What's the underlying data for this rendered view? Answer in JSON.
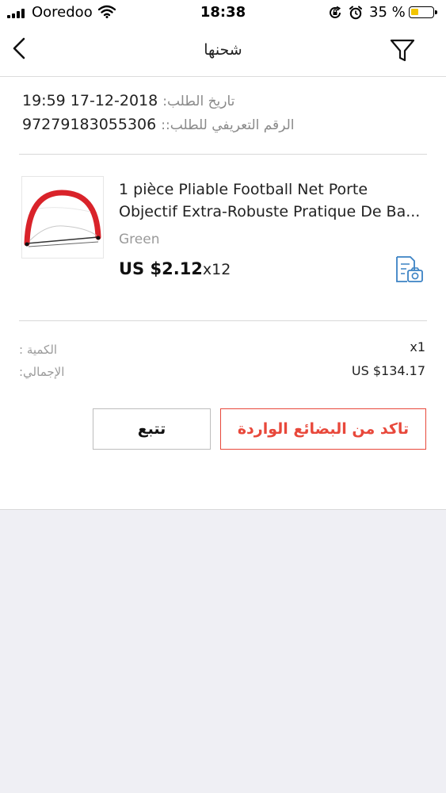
{
  "status_bar": {
    "carrier": "Ooredoo",
    "time": "18:38",
    "battery": "35 %",
    "battery_color": "#f2c500"
  },
  "nav": {
    "back_icon": "chevron-left-icon",
    "title": "شحنها",
    "filter_icon": "filter-icon"
  },
  "order": {
    "date_label": "تاريخ الطلب:",
    "date_value": "19:59 17-12-2018",
    "id_label": "الرقم التعريفي للطلب::",
    "id_value": "97279183055306"
  },
  "product": {
    "title_line1": "1 pièce Pliable Football Net Porte",
    "title_line2": "Objectif Extra-Robuste Pratique De Ba...",
    "color": "Green",
    "price": "US $2.12",
    "quantity": "x12",
    "snapshot_icon": "order-snapshot-icon"
  },
  "summary": {
    "qty_label": "الكمية :",
    "qty_value": "x1",
    "total_label": "الإجمالي:",
    "total_value": "US $134.17"
  },
  "actions": {
    "track_label": "تتبع",
    "confirm_label": "تاكد من البضائع الواردة",
    "accent_color": "#e8483b"
  }
}
